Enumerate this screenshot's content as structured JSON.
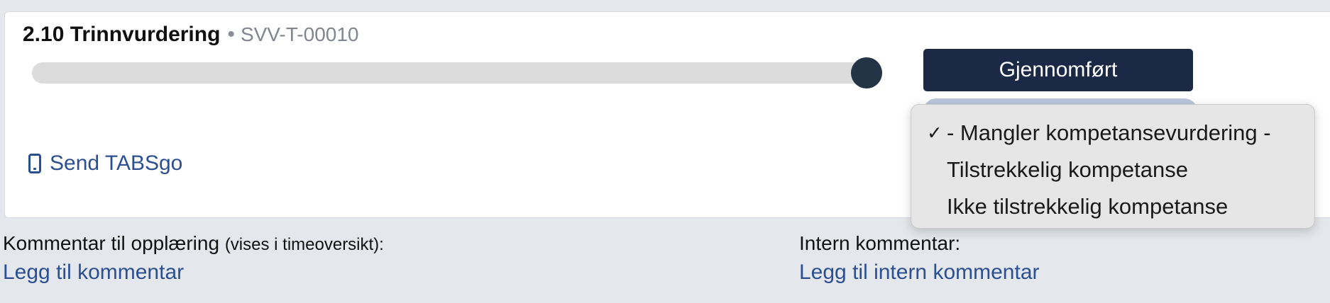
{
  "task": {
    "title": "2.10 Trinnvurdering",
    "separator": "•",
    "code": "SVV-T-00010",
    "progress_percent": 100
  },
  "actions": {
    "done_label": "Gjennomført",
    "send_label": "Send TABSgo"
  },
  "dropdown": {
    "checkmark": "✓",
    "options": [
      {
        "label": "- Mangler kompetansevurdering -",
        "selected": true
      },
      {
        "label": "Tilstrekkelig kompetanse",
        "selected": false
      },
      {
        "label": "Ikke tilstrekkelig kompetanse",
        "selected": false
      }
    ]
  },
  "comments": {
    "training_label": "Kommentar til opplæring",
    "training_hint": "(vises i timeoversikt):",
    "training_link": "Legg til kommentar",
    "internal_label": "Intern kommentar:",
    "internal_link": "Legg til intern kommentar"
  },
  "colors": {
    "primary": "#1b2947",
    "link": "#2b4f91",
    "thumb": "#243447",
    "background": "#e4e7ec"
  }
}
